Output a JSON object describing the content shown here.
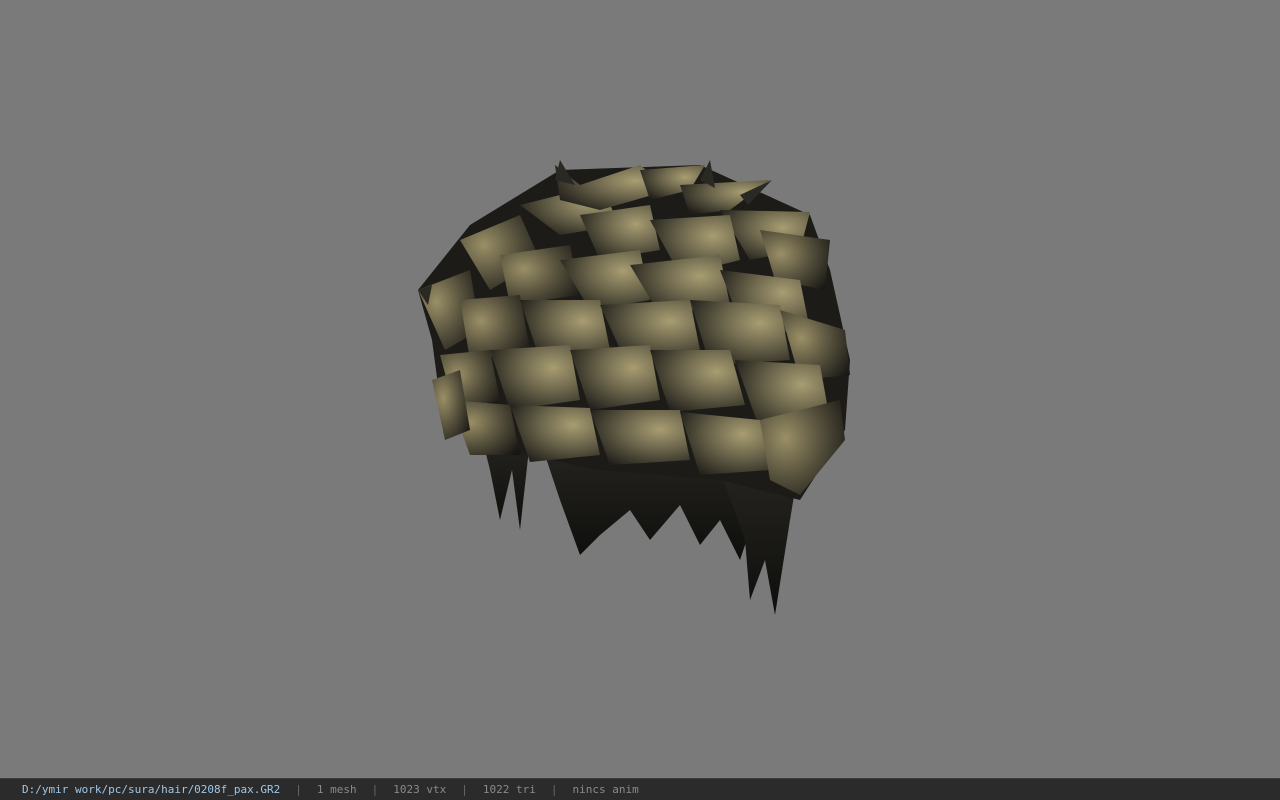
{
  "viewer": {
    "background_color": "#7a7a7a",
    "model": {
      "icon": "hair-mesh-model",
      "shades": {
        "light": "#a89d72",
        "mid": "#6c664c",
        "dark": "#2c2b26",
        "black": "#141412"
      }
    }
  },
  "statusbar": {
    "file_path": "D:/ymir work/pc/sura/hair/0208f_pax.GR2",
    "separator": "|",
    "mesh_count": "1 mesh",
    "vertex_count": "1023 vtx",
    "triangle_count": "1022 tri",
    "anim_info": "nincs anim"
  }
}
